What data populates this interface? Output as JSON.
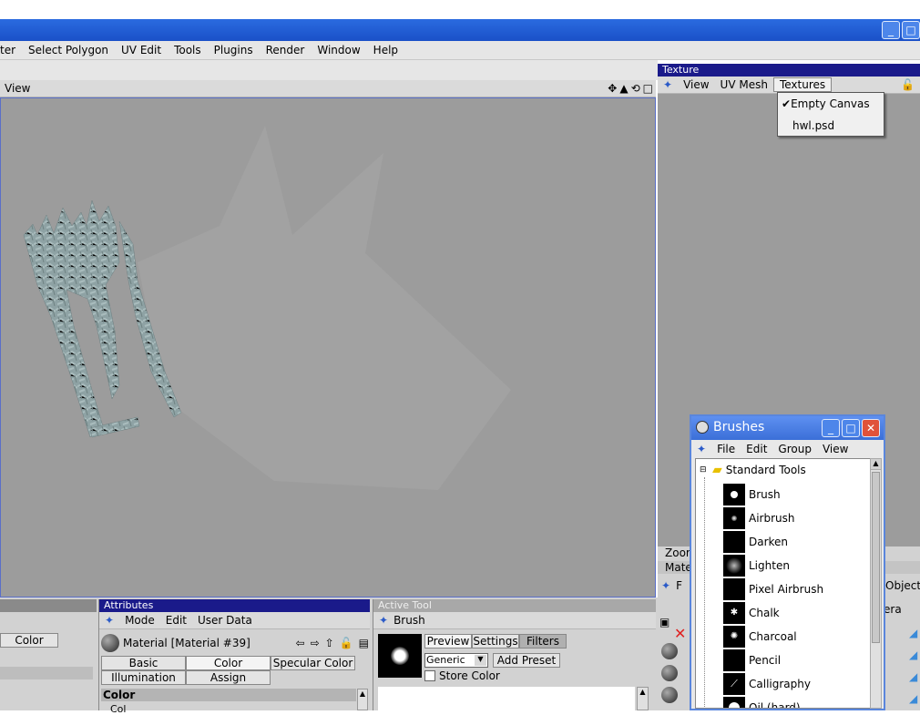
{
  "menubar": [
    "ter",
    "Select Polygon",
    "UV Edit",
    "Tools",
    "Plugins",
    "Render",
    "Window",
    "Help"
  ],
  "viewport": {
    "menu": "View"
  },
  "texture_panel": {
    "title": "Texture",
    "menu": [
      "View",
      "UV Mesh",
      "Textures"
    ],
    "zoom_label": "Zoor",
    "mate_label": "Mate",
    "f_label": "F",
    "object_label": "Object",
    "era_label": "era"
  },
  "textures_dropdown": {
    "items": [
      "Empty Canvas",
      "hwl.psd"
    ],
    "checked": "Empty Canvas"
  },
  "left_pane": {
    "button": "Color"
  },
  "attributes": {
    "title": "Attributes",
    "menu": [
      "Mode",
      "Edit",
      "User Data"
    ],
    "material_name": "Material [Material #39]",
    "tabs_row1": [
      "Basic",
      "Color",
      "Specular Color"
    ],
    "tabs_row2": [
      "Illumination",
      "Assign"
    ],
    "section": "Color",
    "sub": "Col"
  },
  "active_tool": {
    "title": "Active Tool",
    "tool": "Brush",
    "tabs": [
      "Preview",
      "Settings",
      "Filters"
    ],
    "preset_select": "Generic",
    "add_preset": "Add Preset",
    "store_color": "Store Color"
  },
  "brushes": {
    "title": "Brushes",
    "menu": [
      "File",
      "Edit",
      "Group",
      "View"
    ],
    "group": "Standard Tools",
    "items": [
      "Brush",
      "Airbrush",
      "Darken",
      "Lighten",
      "Pixel Airbrush",
      "Chalk",
      "Charcoal",
      "Pencil",
      "Calligraphy",
      "Oil (hard)"
    ]
  }
}
